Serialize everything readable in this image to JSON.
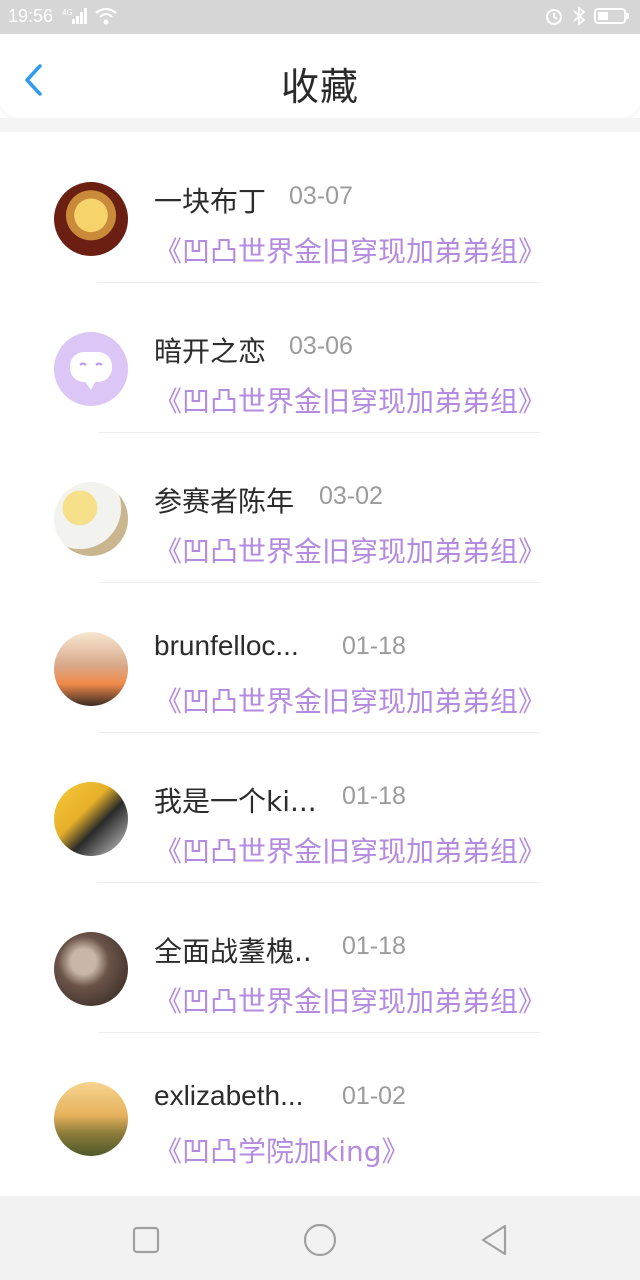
{
  "status_bar": {
    "time": "19:56",
    "network_label": "4G",
    "icons": [
      "signal-icon",
      "wifi-icon",
      "alarm-icon",
      "bluetooth-icon",
      "battery-icon"
    ]
  },
  "header": {
    "title": "收藏",
    "back_icon": "chevron-left-icon",
    "accent_color": "#2f9cf0"
  },
  "colors": {
    "group_link": "#b48be0",
    "date": "#9b9b9b",
    "name": "#2c2c2c"
  },
  "favorites": [
    {
      "name": "一块布丁",
      "date": "03-07",
      "group": "《凹凸世界金旧穿现加弟弟组》"
    },
    {
      "name": "暗开之恋",
      "date": "03-06",
      "group": "《凹凸世界金旧穿现加弟弟组》"
    },
    {
      "name": "参赛者陈年",
      "date": "03-02",
      "group": "《凹凸世界金旧穿现加弟弟组》"
    },
    {
      "name": "brunfelloc...",
      "date": "01-18",
      "group": "《凹凸世界金旧穿现加弟弟组》"
    },
    {
      "name": "我是一个ki...",
      "date": "01-18",
      "group": "《凹凸世界金旧穿现加弟弟组》"
    },
    {
      "name": "全面战耋槐...",
      "date": "01-18",
      "group": "《凹凸世界金旧穿现加弟弟组》"
    },
    {
      "name": "exlizabeth...",
      "date": "01-02",
      "group": "《凹凸学院加king》"
    }
  ],
  "nav_bar": {
    "buttons": [
      "recent-apps-square-icon",
      "home-circle-icon",
      "back-triangle-icon"
    ]
  }
}
